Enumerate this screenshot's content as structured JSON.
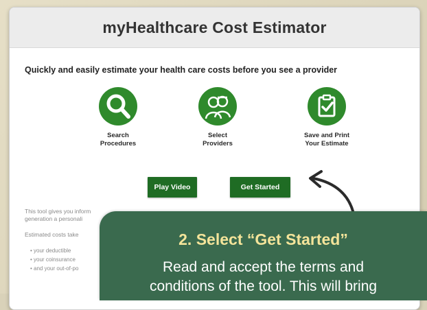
{
  "app": {
    "title": "myHealthcare Cost Estimator",
    "tagline": "Quickly and easily estimate your health care costs before you see a provider"
  },
  "features": [
    {
      "icon": "search-icon",
      "label_line1": "Search",
      "label_line2": "Procedures"
    },
    {
      "icon": "providers-icon",
      "label_line1": "Select",
      "label_line2": "Providers"
    },
    {
      "icon": "checklist-icon",
      "label_line1": "Save and Print",
      "label_line2": "Your Estimate"
    }
  ],
  "buttons": {
    "play_video": "Play Video",
    "get_started": "Get Started"
  },
  "body": {
    "line1": "This tool gives you inform",
    "line2": "generation a personali",
    "line3": "Estimated costs take",
    "bullets": [
      "your deductible",
      "your coinsurance",
      "and your out-of-po"
    ]
  },
  "callout": {
    "heading": "2. Select “Get Started”",
    "text_line1": "Read and accept the terms and",
    "text_line2": "conditions of the tool. This will bring"
  },
  "colors": {
    "brand_green": "#2f8a2c",
    "button_green": "#1f6c24",
    "callout_bg": "#3a6a4e",
    "callout_heading": "#f4e49a"
  }
}
